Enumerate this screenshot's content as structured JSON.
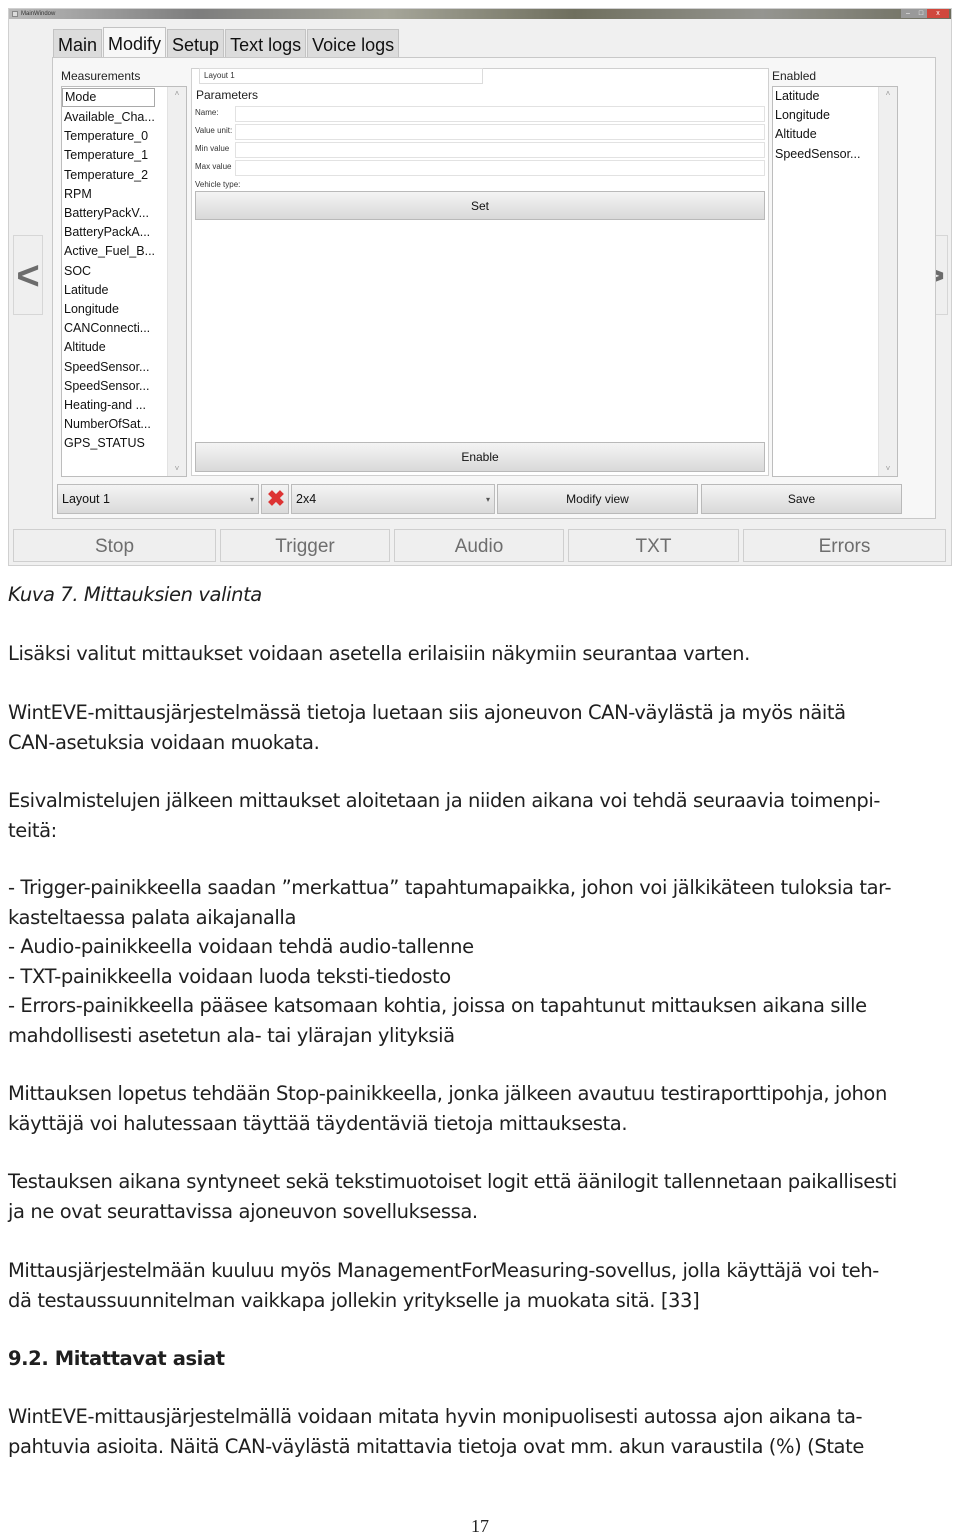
{
  "window": {
    "title": "MainWindow",
    "controls": {
      "minimize": "–",
      "maximize": "□",
      "close": "x"
    }
  },
  "tabs": [
    {
      "label": "Main",
      "active": false
    },
    {
      "label": "Modify",
      "active": true
    },
    {
      "label": "Setup",
      "active": false
    },
    {
      "label": "Text logs",
      "active": false
    },
    {
      "label": "Voice logs",
      "active": false
    }
  ],
  "nav": {
    "prev": "<",
    "next": ">"
  },
  "measurements": {
    "label": "Measurements",
    "selected": "Mode",
    "items": [
      "Mode",
      "Available_Cha...",
      "Temperature_0",
      "Temperature_1",
      "Temperature_2",
      "RPM",
      "BatteryPackV...",
      "BatteryPackA...",
      "Active_Fuel_B...",
      "SOC",
      "Latitude",
      "Longitude",
      "CANConnecti...",
      "Altitude",
      "SpeedSensor...",
      "SpeedSensor...",
      "Heating-and ...",
      "NumberOfSat...",
      "GPS_STATUS"
    ]
  },
  "layout_name": {
    "value": "Layout 1"
  },
  "parameters": {
    "title": "Parameters",
    "fields": [
      {
        "label": "Name:",
        "value": ""
      },
      {
        "label": "Value unit:",
        "value": ""
      },
      {
        "label": "Min value",
        "value": ""
      },
      {
        "label": "Max value",
        "value": ""
      }
    ],
    "vehicle_type_label": "Vehicle type:",
    "set_button": "Set",
    "enable_button": "Enable"
  },
  "enabled": {
    "label": "Enabled",
    "items": [
      "Latitude",
      "Longitude",
      "Altitude",
      "SpeedSensor..."
    ]
  },
  "bottom_bar": {
    "layout_select": "Layout 1",
    "delete_icon": "red-x-icon",
    "grid_select": "2x4",
    "modify_view": "Modify view",
    "save": "Save"
  },
  "footer_buttons": [
    "Stop",
    "Trigger",
    "Audio",
    "TXT",
    "Errors"
  ],
  "document": {
    "caption": "Kuva 7. Mittauksien valinta",
    "p1": "Lisäksi valitut mittaukset voidaan asetella erilaisiin näkymiin seurantaa varten.",
    "p2": [
      "WintEVE-mittausjärjestelmässä tietoja luetaan siis ajoneuvon CAN-väylästä ja myös näitä",
      "CAN-asetuksia voidaan muokata."
    ],
    "p3": [
      "Esivalmistelujen jälkeen mittaukset aloitetaan ja niiden aikana voi tehdä seuraavia toimenpi-",
      "teitä:"
    ],
    "bullets": [
      "- Trigger-painikkeella saadan ”merkattua” tapahtumapaikka, johon voi jälkikäteen tuloksia tar-",
      "kasteltaessa palata aikajanalla",
      "- Audio-painikkeella voidaan tehdä audio-tallenne",
      "- TXT-painikkeella voidaan luoda teksti-tiedosto",
      "- Errors-painikkeella pääsee katsomaan kohtia, joissa on tapahtunut mittauksen aikana sille",
      "mahdollisesti asetetun ala- tai ylärajan ylityksiä"
    ],
    "p4": [
      "Mittauksen lopetus tehdään Stop-painikkeella, jonka jälkeen avautuu testiraporttipohja, johon",
      "käyttäjä voi halutessaan täyttää täydentäviä tietoja mittauksesta."
    ],
    "p5": [
      "Testauksen aikana syntyneet sekä tekstimuotoiset logit että äänilogit tallennetaan paikallisesti",
      "ja ne ovat seurattavissa ajoneuvon sovelluksessa."
    ],
    "p6": [
      "Mittausjärjestelmään kuuluu myös ManagementForMeasuring-sovellus, jolla käyttäjä voi teh-",
      "dä testaussuunnitelman vaikkapa jollekin yritykselle ja muokata sitä. [33]"
    ],
    "heading": "9.2. Mitattavat asiat",
    "p7": [
      "WintEVE-mittausjärjestelmällä voidaan mitata hyvin monipuolisesti autossa ajon aikana ta-",
      "pahtuvia asioita. Näitä CAN-väylästä mitattavia tietoja ovat mm. akun varaustila (%) (State"
    ],
    "page_number": "17"
  }
}
